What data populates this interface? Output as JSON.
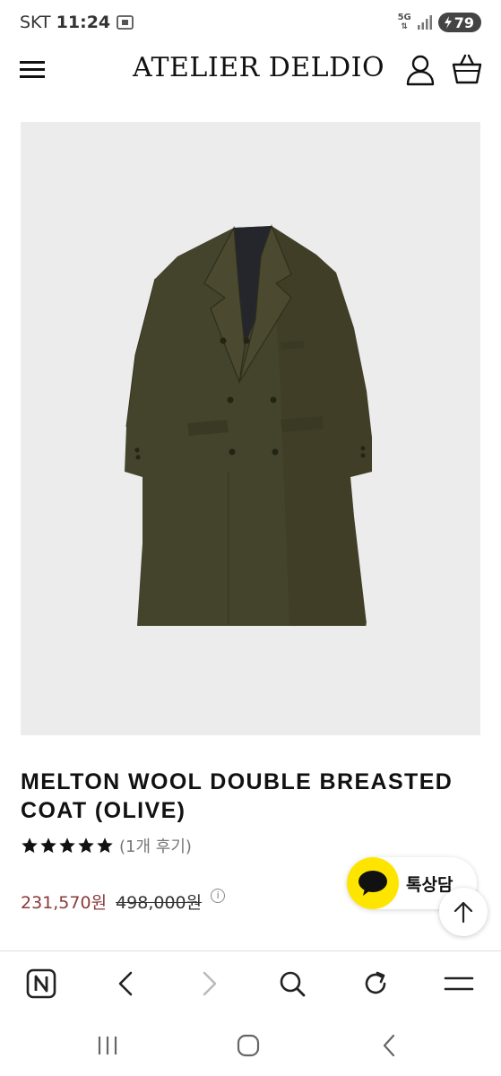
{
  "status_bar": {
    "carrier": "SKT",
    "time": "11:24",
    "network": "5G",
    "battery": "79"
  },
  "header": {
    "brand": "ATELIER DELDIO"
  },
  "product": {
    "title": "MELTON WOOL DOUBLE BREASTED COAT (OLIVE)",
    "rating": 5,
    "review_count": "(1개 후기)",
    "sale_price": "231,570원",
    "original_price": "498,000원",
    "info_symbol": "i",
    "image_background": "#ececec",
    "coat_color": "#44432b"
  },
  "floating": {
    "chat_label": "톡상담",
    "chat_color": "#fee500"
  },
  "browser_bar": {
    "buttons": [
      "naver-icon",
      "back-icon",
      "forward-icon",
      "search-icon",
      "reload-icon",
      "menu-icon"
    ]
  },
  "system_nav": {
    "buttons": [
      "recent-apps-icon",
      "home-icon",
      "back-icon"
    ]
  }
}
